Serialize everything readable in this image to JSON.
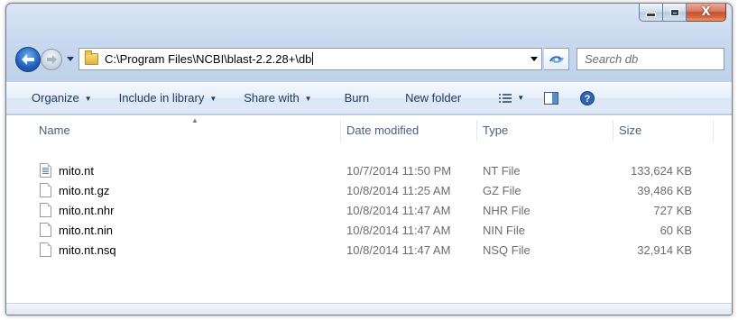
{
  "window": {
    "caption": {
      "minimize_glyph": "minimize-icon",
      "maximize_glyph": "maximize-icon",
      "close_glyph": "X"
    }
  },
  "nav": {
    "back_icon": "back-arrow-icon",
    "forward_icon": "forward-arrow-icon",
    "address": "C:\\Program Files\\NCBI\\blast-2.2.28+\\db",
    "refresh_glyph": "↻",
    "search_placeholder": "Search db"
  },
  "toolbar": {
    "organize": "Organize",
    "include_in_library": "Include in library",
    "share_with": "Share with",
    "burn": "Burn",
    "new_folder": "New folder",
    "views_icon": "view-options-icon",
    "preview_icon": "preview-pane-icon",
    "help_icon": "help-icon"
  },
  "columns": {
    "name": "Name",
    "date_modified": "Date modified",
    "type": "Type",
    "size": "Size"
  },
  "files": [
    {
      "name": "mito.nt",
      "date": "10/7/2014 11:50 PM",
      "type": "NT File",
      "size": "133,624 KB",
      "icon": "text-file-icon"
    },
    {
      "name": "mito.nt.gz",
      "date": "10/8/2014 11:25 AM",
      "type": "GZ File",
      "size": "39,486 KB",
      "icon": "file-icon"
    },
    {
      "name": "mito.nt.nhr",
      "date": "10/8/2014 11:47 AM",
      "type": "NHR File",
      "size": "727 KB",
      "icon": "file-icon"
    },
    {
      "name": "mito.nt.nin",
      "date": "10/8/2014 11:47 AM",
      "type": "NIN File",
      "size": "60 KB",
      "icon": "file-icon"
    },
    {
      "name": "mito.nt.nsq",
      "date": "10/8/2014 11:47 AM",
      "type": "NSQ File",
      "size": "32,914 KB",
      "icon": "file-icon"
    }
  ],
  "colors": {
    "accent": "#1e395b",
    "header_text": "#4c607a",
    "secondary_text": "#6d6d6d",
    "close_button": "#c7502f"
  }
}
